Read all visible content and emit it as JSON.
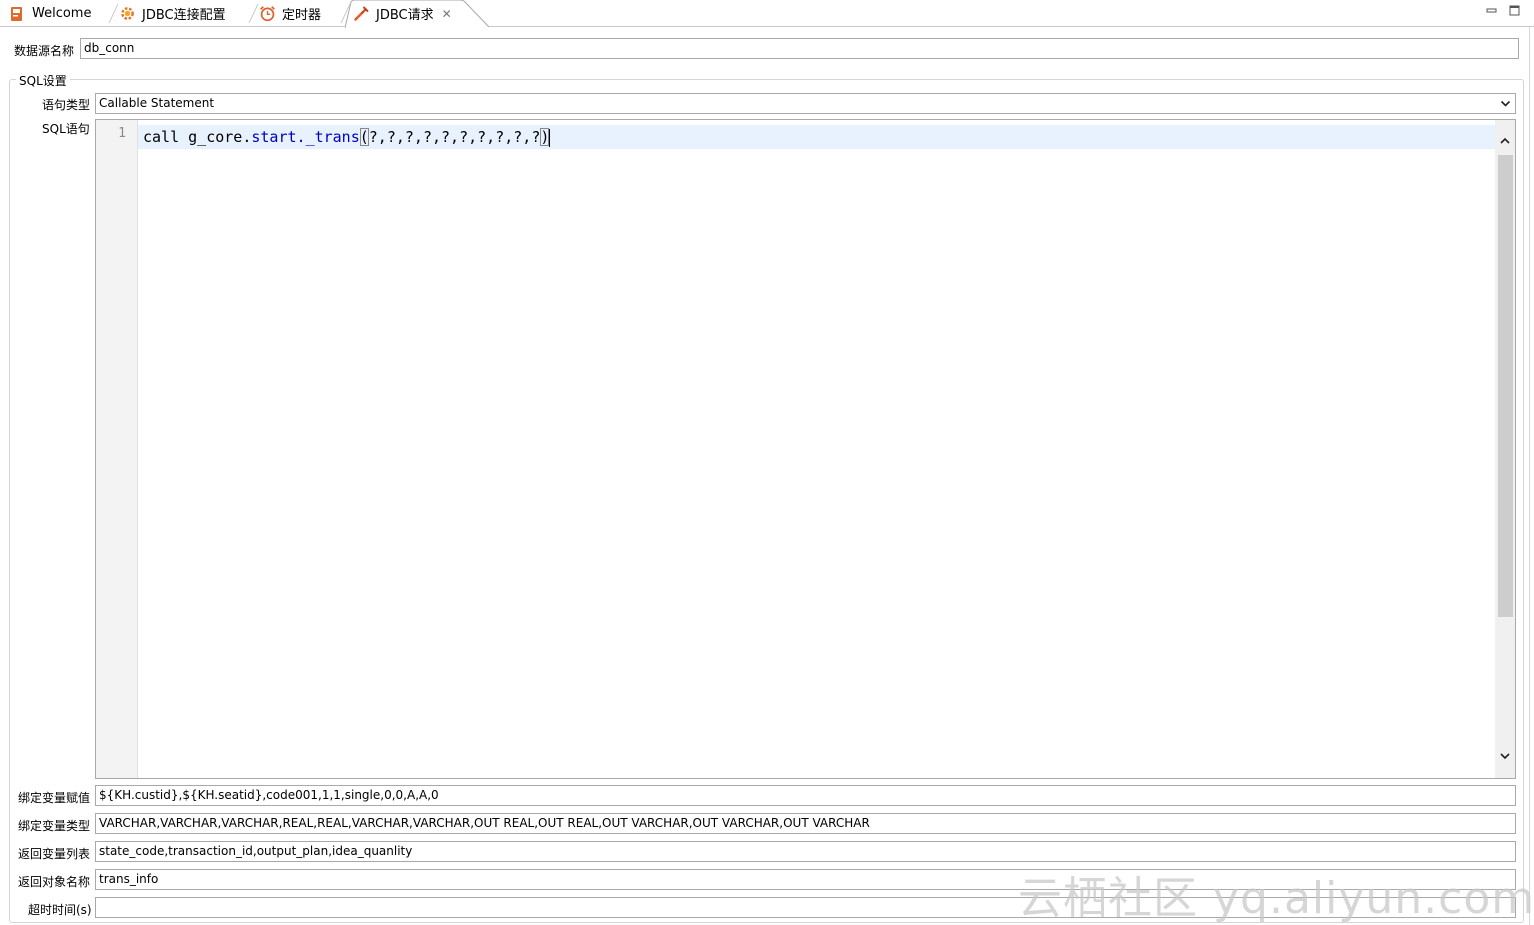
{
  "tabs": [
    {
      "label": "Welcome",
      "icon": "book-icon"
    },
    {
      "label": "JDBC连接配置",
      "icon": "gear-icon"
    },
    {
      "label": "定时器",
      "icon": "alarm-clock-icon"
    },
    {
      "label": "JDBC请求",
      "icon": "dropper-icon",
      "active": true,
      "close": "✕"
    }
  ],
  "form": {
    "datasource_label": "数据源名称",
    "datasource_value": "db_conn",
    "sql_group_title": "SQL设置",
    "stmt_type_label": "语句类型",
    "stmt_type_value": "Callable Statement",
    "sql_label": "SQL语句",
    "line_number": "1",
    "sql_tokens": {
      "call": "call ",
      "schema": "g_core.",
      "pkg": "start.",
      "proc": "_trans",
      "open": "(",
      "params": "?,?,?,?,?,?,?,?,?,?",
      "close": ")"
    },
    "bind_values_label": "绑定变量赋值",
    "bind_values_value": "${KH.custid},${KH.seatid},code001,1,1,single,0,0,A,A,0",
    "bind_types_label": "绑定变量类型",
    "bind_types_value": "VARCHAR,VARCHAR,VARCHAR,REAL,REAL,VARCHAR,VARCHAR,OUT REAL,OUT REAL,OUT VARCHAR,OUT VARCHAR,OUT VARCHAR",
    "return_vars_label": "返回变量列表",
    "return_vars_value": "state_code,transaction_id,output_plan,idea_quanlity",
    "return_obj_label": "返回对象名称",
    "return_obj_value": "trans_info",
    "timeout_label": "超时时间(s)",
    "timeout_value": ""
  },
  "watermark": "云栖社区 yq.aliyun.com",
  "colors": {
    "accent": "#0000c0",
    "current_line": "#e8f2fe"
  }
}
